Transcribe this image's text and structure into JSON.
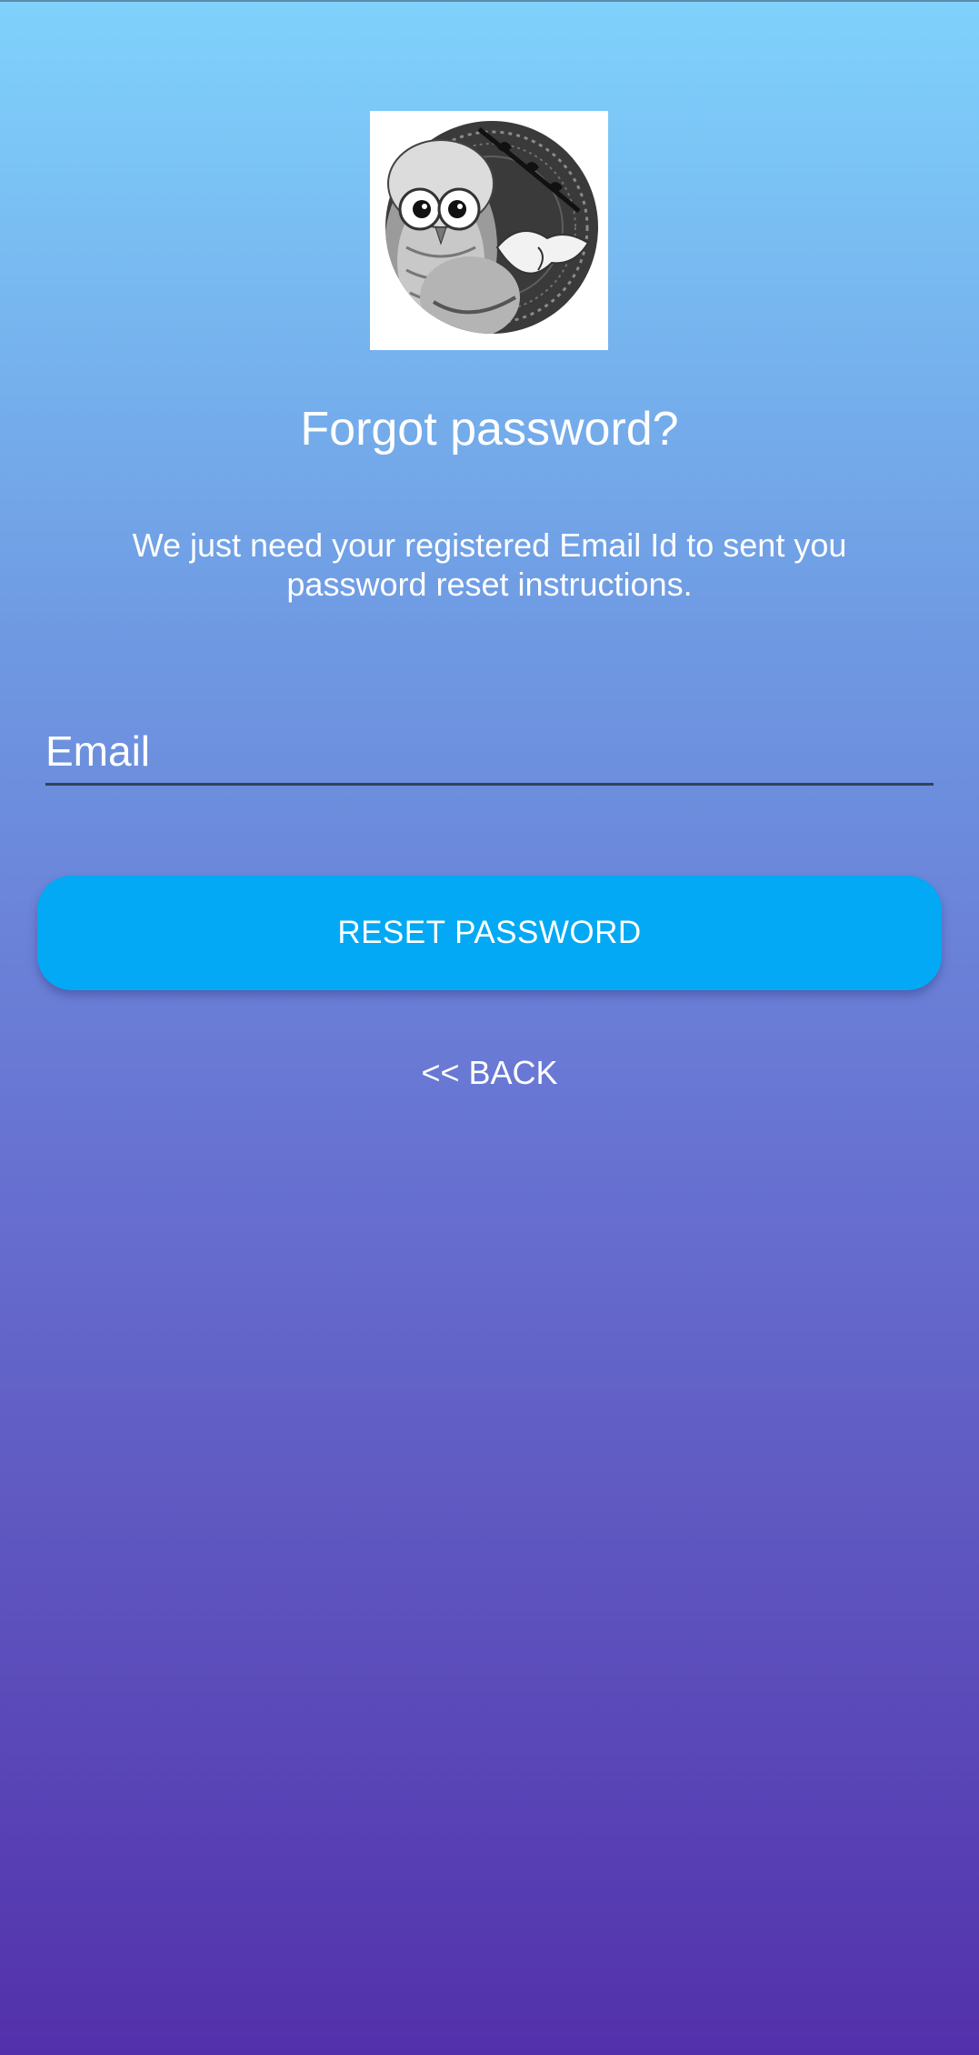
{
  "logo": {
    "image_name": "owl-mandala-logo"
  },
  "screen": {
    "title": "Forgot password?",
    "description": "We just need your registered Email Id to sent you password reset instructions."
  },
  "form": {
    "email_placeholder": "Email",
    "email_value": ""
  },
  "actions": {
    "reset_label": "RESET PASSWORD",
    "back_label": "<< BACK"
  },
  "colors": {
    "gradient_top": "#7fd2fc",
    "gradient_bottom": "#5330ab",
    "button": "#03a9f4",
    "text": "#ffffff"
  }
}
